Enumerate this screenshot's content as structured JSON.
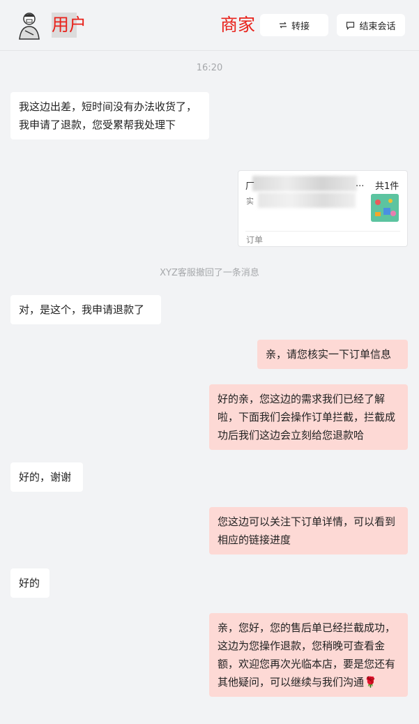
{
  "header": {
    "user_label": "用户",
    "merchant_label": "商家",
    "transfer_label": "转接",
    "end_label": "结束会话"
  },
  "chat": {
    "time": "16:20",
    "recall_notice": "XYZ客服撤回了一条消息",
    "messages": [
      {
        "side": "left",
        "text": "我这边出差，短时间没有办法收货了，我申请了退款，您受累帮我处理下"
      },
      {
        "side": "left",
        "text": "对，是这个，我申请退款了"
      },
      {
        "side": "right",
        "text": "亲，请您核实一下订单信息"
      },
      {
        "side": "right",
        "text": "好的亲，您这边的需求我们已经了解啦，下面我们会操作订单拦截，拦截成功后我们这边会立刻给您退款哈"
      },
      {
        "side": "left",
        "text": "好的，谢谢"
      },
      {
        "side": "right",
        "text": "您这边可以关注下订单详情，可以看到相应的链接进度"
      },
      {
        "side": "left",
        "text": "好的"
      },
      {
        "side": "right",
        "text": "亲，您好，您的售后单已经拦截成功，这边为您操作退款，您稍晚可查看金额，欢迎您再次光临本店，要是您还有其他疑问，可以继续与我们沟通🌹"
      }
    ]
  },
  "order_card": {
    "title_start": "厂",
    "title_end": "...",
    "subtitle": "实",
    "count": "共1件",
    "label": "订单"
  },
  "icons": {
    "transfer": "transfer-arrows-icon",
    "end": "chat-bubble-icon"
  },
  "colors": {
    "accent_red": "#e8221b",
    "agent_bubble": "#fdd9d5",
    "customer_bubble": "#ffffff",
    "background": "#f2f3f5"
  }
}
